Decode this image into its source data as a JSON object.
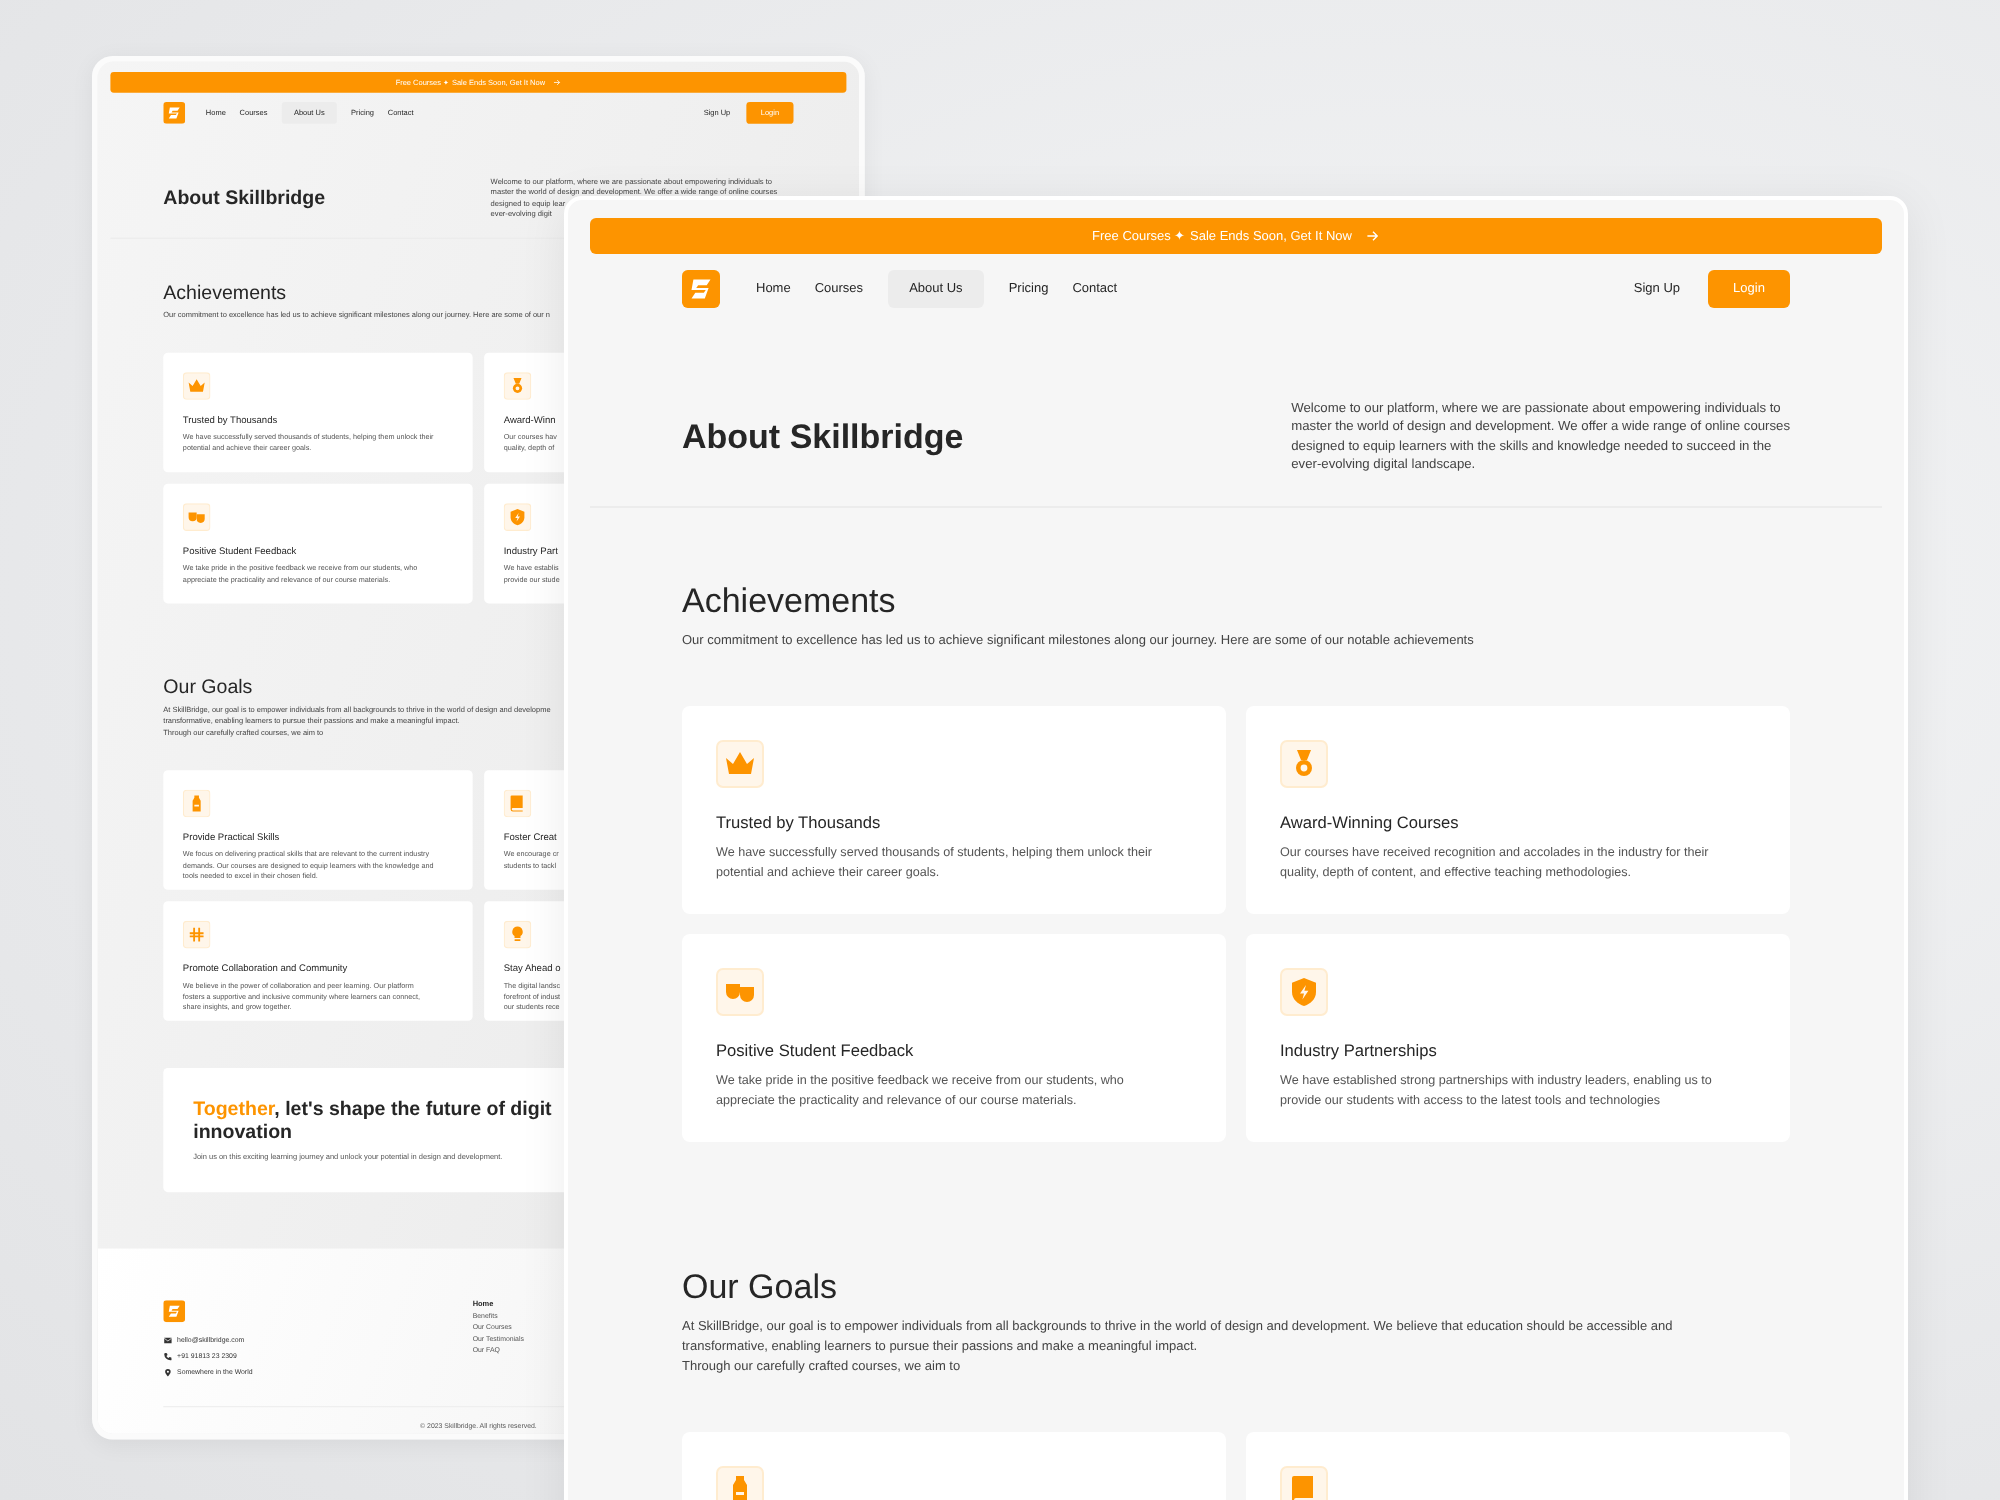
{
  "back_window": {
    "banner": {
      "text": "Free Courses ✦ Sale Ends Soon, Get It Now"
    },
    "nav": {
      "links": [
        {
          "label": "Home",
          "selected": false
        },
        {
          "label": "Courses",
          "selected": false
        },
        {
          "label": "About Us",
          "selected": true
        },
        {
          "label": "Pricing",
          "selected": false
        },
        {
          "label": "Contact",
          "selected": false
        }
      ],
      "sign_up": "Sign Up",
      "login": "Login"
    },
    "hero": {
      "title": "About Skillbridge",
      "intro": [
        "Welcome to our platform, where we are passionate about empowering individuals to",
        "master the world of design and development. We offer a wide range of online courses",
        "designed to equip lear",
        "ever-evolving digit"
      ]
    },
    "achievements": {
      "title": "Achievements",
      "subtitle": [
        "Our commitment to excellence has led us to achieve significant milestones along our journey. Here are some of our n"
      ],
      "cards": [
        {
          "kind": "crown",
          "title": "Trusted by Thousands",
          "desc": [
            "We have successfully served thousands of students, helping them unlock their",
            "potential and achieve their career goals."
          ]
        },
        {
          "kind": "medal",
          "title": "Award-Winn",
          "desc": [
            "Our courses hav",
            "quality, depth of"
          ]
        },
        {
          "kind": "masks",
          "title": "Positive Student Feedback",
          "desc": [
            "We take pride in the positive feedback we receive from our students, who",
            "appreciate the practicality and relevance of our course materials."
          ]
        },
        {
          "kind": "shield",
          "title": "Industry Part",
          "desc": [
            "We have establis",
            "provide our stude"
          ]
        }
      ]
    },
    "goals": {
      "title": "Our Goals",
      "intro": [
        "At SkillBridge, our goal is to empower individuals from all backgrounds to thrive in the world of design and developme",
        "transformative, enabling learners to pursue their passions and make a meaningful impact.",
        "Through our carefully crafted courses, we aim to"
      ],
      "cards": [
        {
          "kind": "bottle",
          "title": "Provide Practical Skills",
          "desc": [
            "We focus on delivering practical skills that are relevant to the current industry",
            "demands. Our courses are designed to equip learners with the knowledge and",
            "tools needed to excel in their chosen field."
          ]
        },
        {
          "kind": "book",
          "title": "Foster Creat",
          "desc": [
            "We encourage cr",
            "students to tackl"
          ]
        },
        {
          "kind": "hash",
          "title": "Promote Collaboration and Community",
          "desc": [
            "We believe in the power of collaboration and peer learning. Our platform",
            "fosters a supportive and inclusive community where learners can connect,",
            "share insights, and grow together."
          ]
        },
        {
          "kind": "bulb",
          "title": "Stay Ahead o",
          "desc": [
            "The digital landsc",
            "forefront of indust",
            "our students rece"
          ]
        }
      ]
    },
    "cta": {
      "highlight": "Together",
      "heading_rest": ", let's shape the future of digit",
      "heading_line2": "innovation",
      "text": "Join us on this exciting learning journey and unlock your potential in design and development."
    },
    "footer": {
      "contacts": [
        {
          "kind": "email",
          "text": "hello@skillbridge.com"
        },
        {
          "kind": "phone",
          "text": "+91 91813 23 2309"
        },
        {
          "kind": "location",
          "text": "Somewhere in the World"
        }
      ],
      "link_heading": "Home",
      "links": [
        "Benefits",
        "Our Courses",
        "Our Testimonials",
        "Our FAQ"
      ],
      "copyright": "© 2023 Skillbridge. All rights reserved."
    }
  },
  "front_window": {
    "banner": {
      "text": "Free Courses ✦ Sale Ends Soon, Get It Now"
    },
    "nav": {
      "links": [
        {
          "label": "Home",
          "selected": false
        },
        {
          "label": "Courses",
          "selected": false
        },
        {
          "label": "About Us",
          "selected": true
        },
        {
          "label": "Pricing",
          "selected": false
        },
        {
          "label": "Contact",
          "selected": false
        }
      ],
      "sign_up": "Sign Up",
      "login": "Login"
    },
    "hero": {
      "title": "About Skillbridge",
      "intro": [
        "Welcome to our platform, where we are passionate about empowering individuals to",
        "master the world of design and development. We offer a wide range of online courses",
        "designed to equip learners with the skills and knowledge needed to succeed in the",
        "ever-evolving digital landscape."
      ]
    },
    "achievements": {
      "title": "Achievements",
      "subtitle": [
        "Our commitment to excellence has led us to achieve significant milestones along our journey. Here are some of our notable achievements"
      ],
      "cards": [
        {
          "kind": "crown",
          "title": "Trusted by Thousands",
          "desc": [
            "We have successfully served thousands of students, helping them unlock their",
            "potential and achieve their career goals."
          ]
        },
        {
          "kind": "medal",
          "title": "Award-Winning Courses",
          "desc": [
            "Our courses have received recognition and accolades in the industry for their",
            "quality, depth of content, and effective teaching methodologies."
          ]
        },
        {
          "kind": "masks",
          "title": "Positive Student Feedback",
          "desc": [
            "We take pride in the positive feedback we receive from our students, who",
            "appreciate the practicality and relevance of our course materials."
          ]
        },
        {
          "kind": "shield",
          "title": "Industry Partnerships",
          "desc": [
            "We have established strong partnerships with industry leaders, enabling us to",
            "provide our students with access to the latest tools and technologies"
          ]
        }
      ]
    },
    "goals": {
      "title": "Our Goals",
      "intro": [
        "At SkillBridge, our goal is to empower individuals from all backgrounds to thrive in the world of design and development. We believe that education should be accessible and",
        "transformative, enabling learners to pursue their passions and make a meaningful impact.",
        "Through our carefully crafted courses, we aim to"
      ],
      "cards": [
        {
          "kind": "bottle"
        },
        {
          "kind": "book"
        }
      ]
    }
  }
}
